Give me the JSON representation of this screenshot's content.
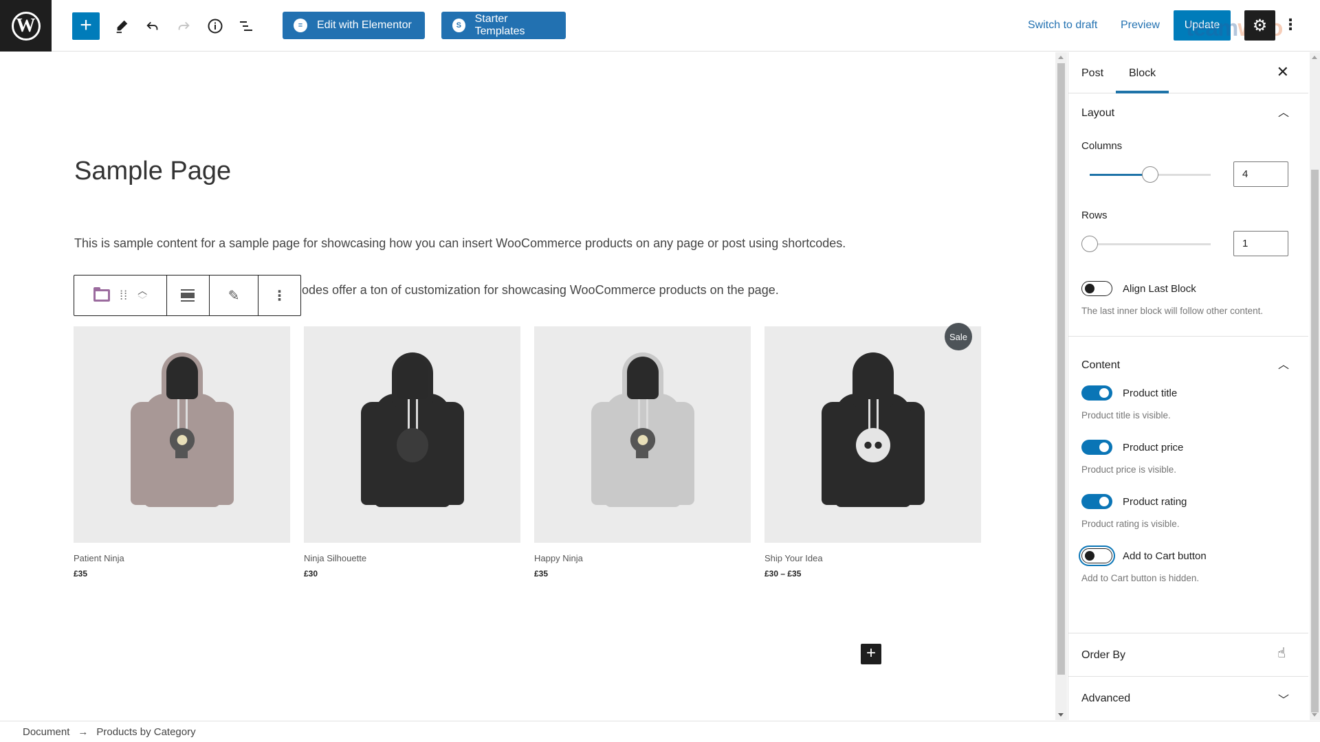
{
  "topbar": {
    "logo_label": "W",
    "inserter_icon": "plus-icon",
    "tools": [
      "pencil-icon",
      "undo-icon",
      "redo-icon",
      "info-icon",
      "list-view-icon"
    ],
    "edit_elementor_label": "Edit with Elementor",
    "starter_templates_label": "Starter Templates",
    "switch_draft_label": "Switch to draft",
    "preview_label": "Preview",
    "update_label": "Update",
    "watermark_a": "team",
    "watermark_b": "woo"
  },
  "editor": {
    "page_title": "Sample Page",
    "paragraph_1": "This is sample content for a sample page for showcasing how you can insert WooCommerce products on any page or post using shortcodes.",
    "paragraph_2": "odes offer a ton of customization for showcasing WooCommerce products on the page.",
    "products": [
      {
        "name": "Patient Ninja",
        "price": "£35",
        "sale": false,
        "color": "#a89896",
        "print": "ninja"
      },
      {
        "name": "Ninja Silhouette",
        "price": "£30",
        "sale": false,
        "color": "#2b2b2b",
        "print": "silhouette"
      },
      {
        "name": "Happy Ninja",
        "price": "£35",
        "sale": false,
        "color": "#c9c9c9",
        "print": "ninja"
      },
      {
        "name": "Ship Your Idea",
        "price": "£30 – £35",
        "sale": true,
        "sale_label": "Sale",
        "color": "#2a2a2a",
        "print": "skull"
      }
    ]
  },
  "sidebar": {
    "tabs": [
      {
        "label": "Post",
        "active": false
      },
      {
        "label": "Block",
        "active": true
      }
    ],
    "layout": {
      "title": "Layout",
      "columns_label": "Columns",
      "columns_value": "4",
      "columns_fraction": 0.5,
      "rows_label": "Rows",
      "rows_value": "1",
      "rows_fraction": 0.0,
      "align_last_label": "Align Last Block",
      "align_last_on": false,
      "align_last_help": "The last inner block will follow other content."
    },
    "content": {
      "title": "Content",
      "toggles": [
        {
          "label": "Product title",
          "on": true,
          "help": "Product title is visible."
        },
        {
          "label": "Product price",
          "on": true,
          "help": "Product price is visible."
        },
        {
          "label": "Product rating",
          "on": true,
          "help": "Product rating is visible."
        },
        {
          "label": "Add to Cart button",
          "on": false,
          "help": "Add to Cart button is hidden."
        }
      ]
    },
    "order_by_title": "Order By",
    "advanced_title": "Advanced"
  },
  "footer": {
    "breadcrumb": [
      "Document",
      "Products by Category"
    ],
    "separator": "→"
  }
}
